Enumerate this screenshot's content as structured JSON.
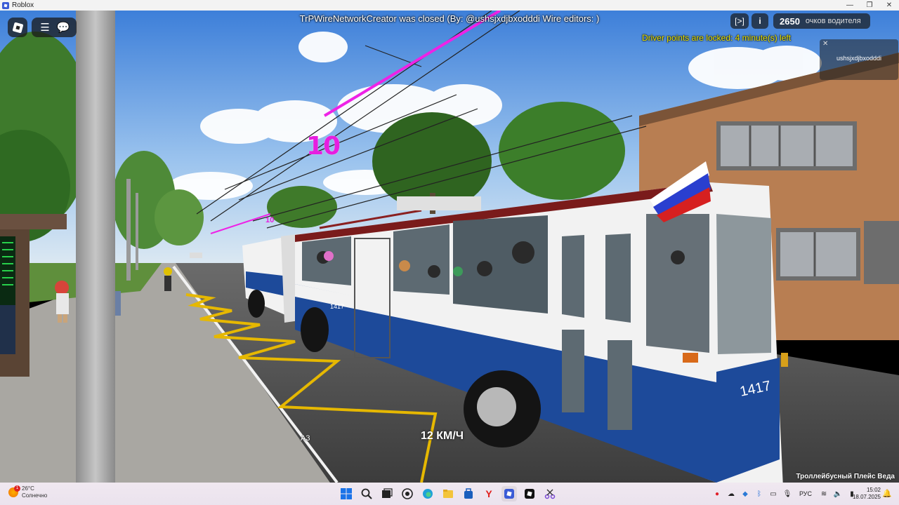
{
  "window": {
    "title": "Roblox",
    "controls": [
      "—",
      "❐",
      "✕"
    ]
  },
  "hud": {
    "notice": "TrPWireNetworkCreator was closed (By: @ushsjxdjbxodddi Wire editors: )",
    "driver_lock": "Driver points are locked: 4 minute(s) left",
    "expand_label": "[>]",
    "info_label": "i",
    "points_value": "2650",
    "points_label": "очков водителя",
    "player_name": "ushsjxdjbxodddi",
    "route_number": "10",
    "route_number_small": "10",
    "speed": "12 КМ/Ч",
    "lane_label": "A3",
    "location": "Троллейбусный Плейс Веда"
  },
  "bus": {
    "fleet_number": "1417",
    "side_number": "1417"
  },
  "taskbar": {
    "weather_temp": "26°C",
    "weather_desc": "Солнечно",
    "weather_badge": "1",
    "apps": [
      "windows-start",
      "search",
      "task-view",
      "whatsapp",
      "edge",
      "file-explorer",
      "store",
      "yandex",
      "roblox",
      "roblox-studio",
      "snipping-tool"
    ],
    "tray_lang": "РУС",
    "clock_time": "15:02",
    "clock_date": "18.07.2025"
  },
  "colors": {
    "bus_blue": "#1d4a9a",
    "bus_white": "#f2f2f2",
    "route_magenta": "#e61ee0",
    "driver_lock_yellow": "#e8e000",
    "sky_top": "#3d7fd9"
  }
}
